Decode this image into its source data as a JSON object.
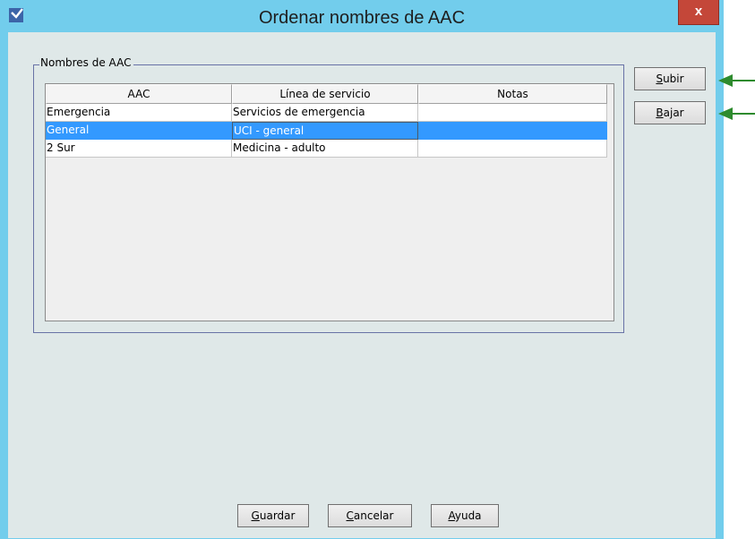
{
  "window": {
    "title": "Ordenar nombres de AAC",
    "close_label": "x",
    "accent": "#72cdec",
    "close_color": "#c44739"
  },
  "group": {
    "label": "Nombres de AAC"
  },
  "table": {
    "columns": [
      "AAC",
      "Línea de servicio",
      "Notas"
    ],
    "rows": [
      {
        "aac": "Emergencia",
        "linea": "Servicios de emergencia",
        "notas": "",
        "selected": false
      },
      {
        "aac": "General",
        "linea": "UCI - general",
        "notas": "",
        "selected": true
      },
      {
        "aac": "2 Sur",
        "linea": "Medicina - adulto",
        "notas": "",
        "selected": false
      }
    ],
    "selection_color": "#3399ff"
  },
  "buttons": {
    "subir": {
      "mnemonic": "S",
      "rest": "ubir"
    },
    "bajar": {
      "mnemonic": "B",
      "rest": "ajar"
    },
    "guardar": {
      "mnemonic": "G",
      "rest": "uardar"
    },
    "cancelar": {
      "mnemonic": "C",
      "rest": "ancelar"
    },
    "ayuda": {
      "mnemonic": "A",
      "rest": "yuda"
    }
  },
  "annotations": {
    "arrow_color": "#2e8b2e"
  }
}
